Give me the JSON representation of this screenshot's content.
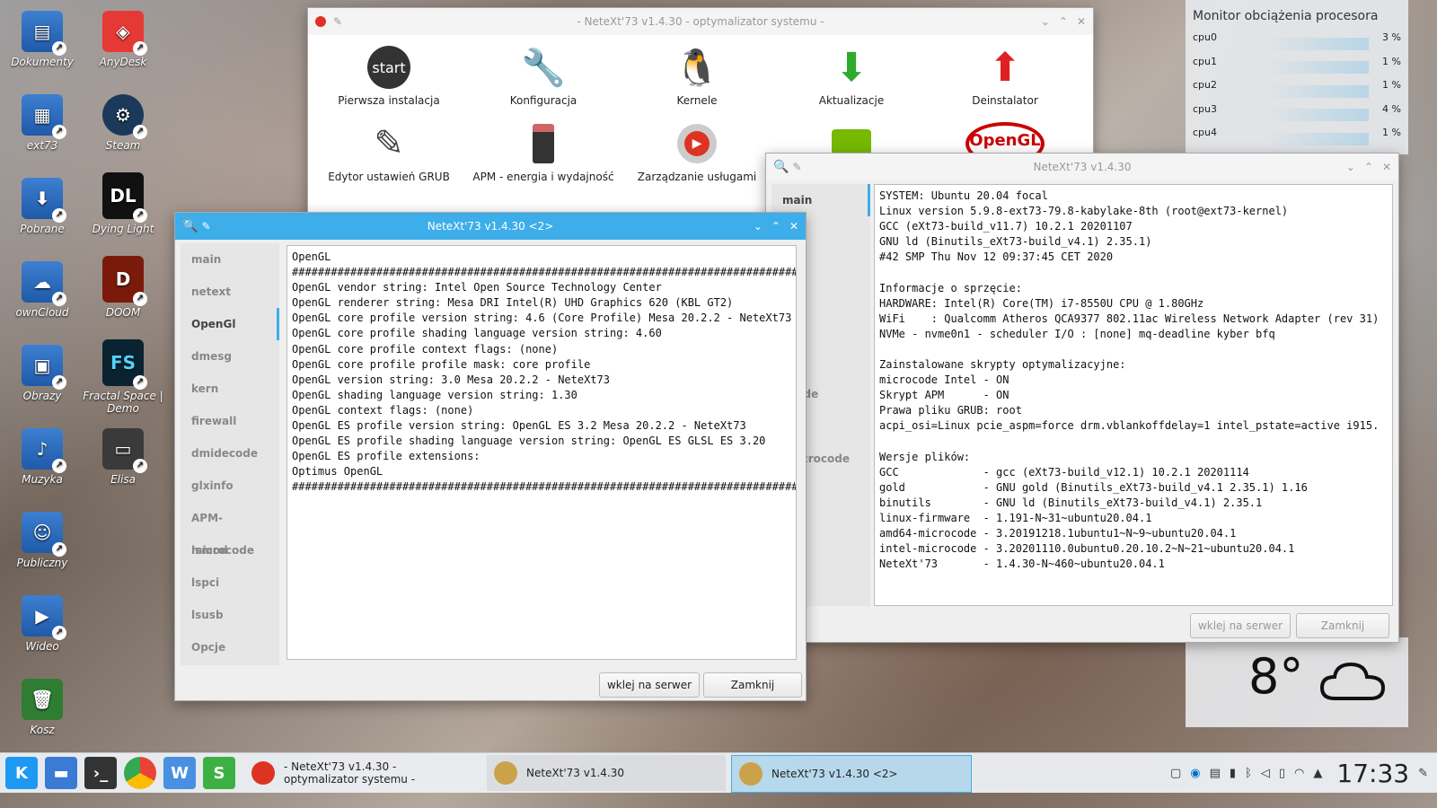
{
  "desktop_icons": [
    {
      "label": "Dokumenty"
    },
    {
      "label": "AnyDesk"
    },
    {
      "label": "ext73"
    },
    {
      "label": "Steam"
    },
    {
      "label": "Pobrane"
    },
    {
      "label": "Dying Light"
    },
    {
      "label": "ownCloud"
    },
    {
      "label": "DOOM"
    },
    {
      "label": "Obrazy"
    },
    {
      "label": "Fractal Space | Demo"
    },
    {
      "label": "Muzyka"
    },
    {
      "label": "Elisa"
    },
    {
      "label": "Publiczny"
    },
    {
      "label": "Wideo"
    },
    {
      "label": "Kosz"
    }
  ],
  "main_window": {
    "title": "- NeteXt'73 v1.4.30 - optymalizator systemu -",
    "launchers": [
      {
        "label": "Pierwsza instalacja",
        "icon": "start"
      },
      {
        "label": "Konfiguracja"
      },
      {
        "label": "Kernele"
      },
      {
        "label": "Aktualizacje"
      },
      {
        "label": "Deinstalator"
      },
      {
        "label": "Edytor ustawień GRUB"
      },
      {
        "label": "APM - energia i wydajność"
      },
      {
        "label": "Zarządzanie usługami"
      }
    ]
  },
  "win2": {
    "title": "NeteXt'73 v1.4.30",
    "nav": [
      "main",
      "xt",
      "nGl",
      "sg",
      "",
      "all",
      "ecode",
      "fo",
      "-microcode",
      "d",
      "",
      "",
      "e"
    ],
    "text": "SYSTEM: Ubuntu 20.04 focal\nLinux version 5.9.8-ext73-79.8-kabylake-8th (root@ext73-kernel)\nGCC (eXt73-build_v11.7) 10.2.1 20201107\nGNU ld (Binutils_eXt73-build_v4.1) 2.35.1)\n#42 SMP Thu Nov 12 09:37:45 CET 2020\n\nInformacje o sprzęcie:\nHARDWARE: Intel(R) Core(TM) i7-8550U CPU @ 1.80GHz\nWiFi    : Qualcomm Atheros QCA9377 802.11ac Wireless Network Adapter (rev 31)\nNVMe - nvme0n1 - scheduler I/O : [none] mq-deadline kyber bfq\n\nZainstalowane skrypty optymalizacyjne:\nmicrocode Intel - ON\nSkrypt APM      - ON\nPrawa pliku GRUB: root\nacpi_osi=Linux pcie_aspm=force drm.vblankoffdelay=1 intel_pstate=active i915.\n\nWersje plików:\nGCC             - gcc (eXt73-build_v12.1) 10.2.1 20201114\ngold            - GNU gold (Binutils_eXt73-build_v4.1 2.35.1) 1.16\nbinutils        - GNU ld (Binutils_eXt73-build_v4.1) 2.35.1\nlinux-firmware  - 1.191-N~31~ubuntu20.04.1\namd64-microcode - 3.20191218.1ubuntu1~N~9~ubuntu20.04.1\nintel-microcode - 3.20201110.0ubuntu0.20.10.2~N~21~ubuntu20.04.1\nNeteXt'73       - 1.4.30-N~460~ubuntu20.04.1",
    "btn_paste": "wklej na serwer",
    "btn_close": "Zamknij"
  },
  "win3": {
    "title": "NeteXt'73 v1.4.30 <2>",
    "nav": [
      "main",
      "netext",
      "OpenGl",
      "dmesg",
      "kern",
      "firewall",
      "dmidecode",
      "glxinfo",
      "APM-microcode",
      "lsmod",
      "lspci",
      "lsusb",
      "Opcje"
    ],
    "selected": "OpenGl",
    "text": "OpenGL\n################################################################################\nOpenGL vendor string: Intel Open Source Technology Center\nOpenGL renderer string: Mesa DRI Intel(R) UHD Graphics 620 (KBL GT2)\nOpenGL core profile version string: 4.6 (Core Profile) Mesa 20.2.2 - NeteXt73\nOpenGL core profile shading language version string: 4.60\nOpenGL core profile context flags: (none)\nOpenGL core profile profile mask: core profile\nOpenGL version string: 3.0 Mesa 20.2.2 - NeteXt73\nOpenGL shading language version string: 1.30\nOpenGL context flags: (none)\nOpenGL ES profile version string: OpenGL ES 3.2 Mesa 20.2.2 - NeteXt73\nOpenGL ES profile shading language version string: OpenGL ES GLSL ES 3.20\nOpenGL ES profile extensions:\nOptimus OpenGL\n################################################################################",
    "btn_paste": "wklej na serwer",
    "btn_close": "Zamknij"
  },
  "cpu_monitor": {
    "title": "Monitor obciążenia procesora",
    "cpus": [
      {
        "name": "cpu0",
        "value": "3 %"
      },
      {
        "name": "cpu1",
        "value": "1 %"
      },
      {
        "name": "cpu2",
        "value": "1 %"
      },
      {
        "name": "cpu3",
        "value": "4 %"
      },
      {
        "name": "cpu4",
        "value": "1 %"
      }
    ]
  },
  "weather": {
    "temp": "8°",
    "icon": "cloud-icon"
  },
  "taskbar": {
    "tasks": [
      "- NeteXt'73 v1.4.30 - optymalizator systemu -",
      "NeteXt'73 v1.4.30",
      "NeteXt'73 v1.4.30 <2>"
    ],
    "clock": "17:33"
  }
}
